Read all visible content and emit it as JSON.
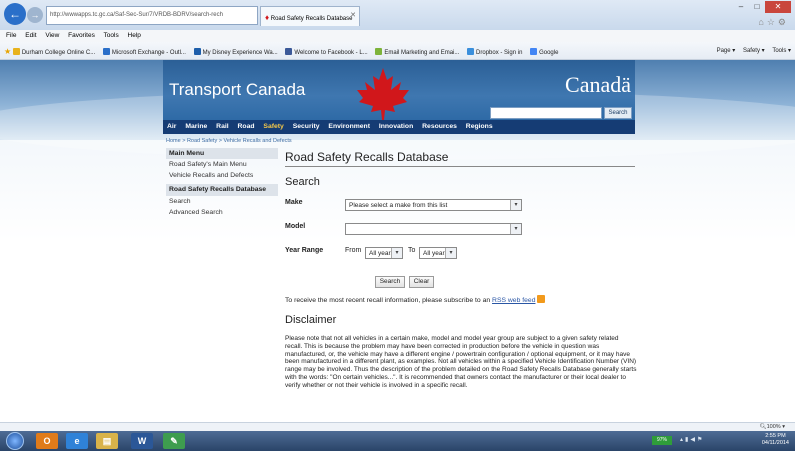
{
  "browser": {
    "address": "http://wwwapps.tc.gc.ca/Saf-Sec-Sur/7/VRDB-BDRV/search-rech",
    "tab_title": "Road Safety Recalls Database",
    "menu": [
      "File",
      "Edit",
      "View",
      "Favorites",
      "Tools",
      "Help"
    ],
    "favorites": [
      "Durham College Online C...",
      "Microsoft Exchange - Outl...",
      "My Disney Experience Wa...",
      "Welcome to Facebook - L...",
      "Email Marketing and Emai...",
      "Dropbox - Sign in",
      "Google"
    ],
    "commands": [
      "Page ▾",
      "Safety ▾",
      "Tools ▾"
    ],
    "zoom": "100%"
  },
  "banner": {
    "dept": "Transport Canada",
    "wordmark": "Canadä",
    "search_button": "Search"
  },
  "topnav": [
    "Air",
    "Marine",
    "Rail",
    "Road",
    "Safety",
    "Security",
    "Environment",
    "Innovation",
    "Resources",
    "Regions"
  ],
  "breadcrumb": "Home > Road Safety > Vehicle Recalls and Defects",
  "leftnav": {
    "head": "Main Menu",
    "links": [
      "Road Safety's Main Menu",
      "Vehicle Recalls and Defects"
    ],
    "current": "Road Safety Recalls Database",
    "sublinks": [
      "Search",
      "Advanced Search"
    ]
  },
  "main": {
    "title": "Road Safety Recalls Database",
    "search_heading": "Search",
    "make_label": "Make",
    "make_value": "Please select a make from this list",
    "model_label": "Model",
    "model_value": "",
    "year_label": "Year Range",
    "from_label": "From",
    "from_value": "All years",
    "to_label": "To",
    "to_value": "All years",
    "search_btn": "Search",
    "clear_btn": "Clear",
    "rss_text": "To receive the most recent recall information, please subscribe to an ",
    "rss_link": "RSS web feed",
    "disclaimer_heading": "Disclaimer",
    "disclaimer": "Please note that not all vehicles in a certain make, model and model year group are subject to a given safety related recall. This is because the problem may have been corrected in production before the vehicle in question was manufactured, or, the vehicle may have a different engine / powertrain configuration / optional equipment, or it may have been manufactured in a different plant, as examples. Not all vehicles within a specified Vehicle Identification Number (VIN) range may be involved. Thus the description of the problem detailed on the Road Safety Recalls Database generally starts with the words: \"On certain vehicles...\". It is recommended that owners contact the manufacturer or their local dealer to verify whether or not their vehicle is involved in a specific recall."
  },
  "taskbar": {
    "battery": "97%",
    "time": "2:55 PM",
    "date": "04/11/2014"
  },
  "colors": {
    "banner_blue": "#3f77b0",
    "nav_dark_blue": "#153c74",
    "nav_highlight": "#f7c948",
    "maple_red": "#d1171b"
  }
}
